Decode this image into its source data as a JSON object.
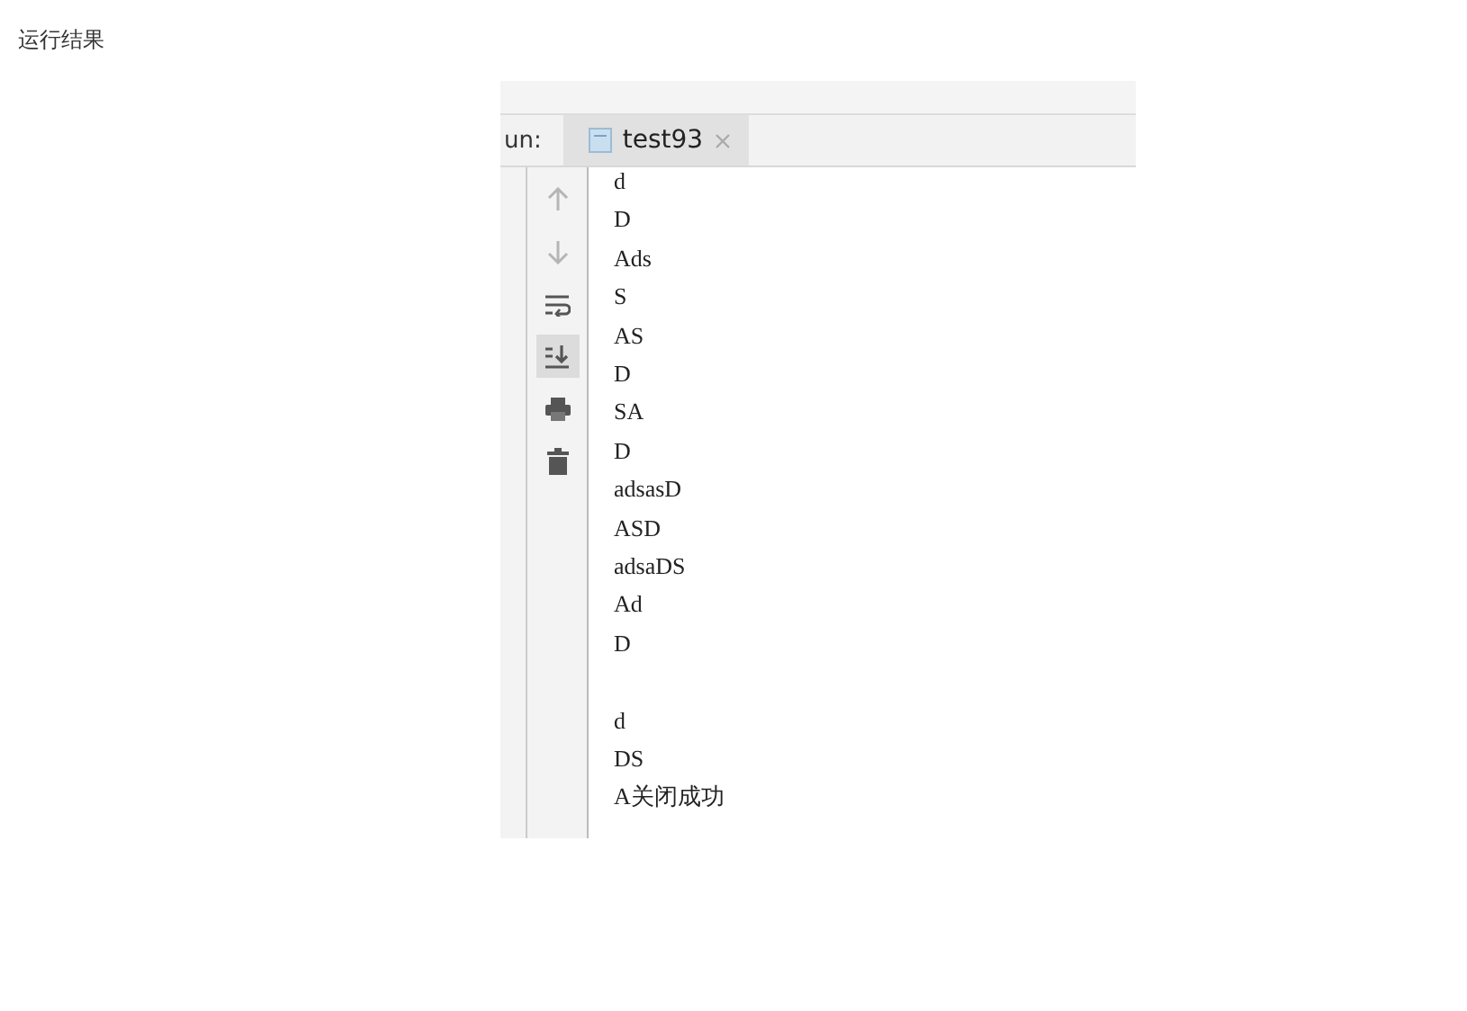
{
  "heading": "运行结果",
  "run_panel": {
    "label": "un:",
    "tabs": [
      {
        "label": "test93",
        "selected": true
      }
    ],
    "tools": [
      {
        "kind": "up",
        "on": false
      },
      {
        "kind": "down",
        "on": false
      },
      {
        "kind": "wrap",
        "on": false
      },
      {
        "kind": "scroll-end",
        "on": true
      },
      {
        "kind": "print",
        "on": false
      },
      {
        "kind": "trash",
        "on": false
      }
    ],
    "output": [
      {
        "text": "d",
        "blank_before": false
      },
      {
        "text": "D",
        "blank_before": false
      },
      {
        "text": "Ads",
        "blank_before": false
      },
      {
        "text": "S",
        "blank_before": false
      },
      {
        "text": "AS",
        "blank_before": false
      },
      {
        "text": "D",
        "blank_before": false
      },
      {
        "text": "SA",
        "blank_before": false
      },
      {
        "text": "D",
        "blank_before": false
      },
      {
        "text": "adsasD",
        "blank_before": false
      },
      {
        "text": "ASD",
        "blank_before": false
      },
      {
        "text": "adsaDS",
        "blank_before": false
      },
      {
        "text": "Ad",
        "blank_before": false
      },
      {
        "text": "D",
        "blank_before": false
      },
      {
        "text": "d",
        "blank_before": true
      },
      {
        "text": "DS",
        "blank_before": false
      },
      {
        "text": "A关闭成功",
        "blank_before": false
      }
    ]
  }
}
